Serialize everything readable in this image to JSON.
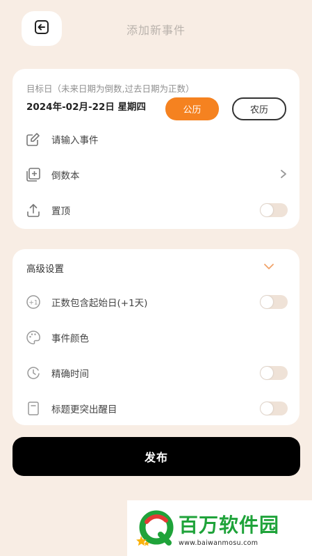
{
  "header": {
    "title": "添加新事件"
  },
  "target": {
    "hint": "目标日（未来日期为倒数,过去日期为正数）",
    "date": "2024年-02月-22日 星期四",
    "solar_label": "公历",
    "lunar_label": "农历"
  },
  "basic": {
    "event_placeholder": "请输入事件",
    "book_label": "倒数本",
    "pin_label": "置顶",
    "pin_on": false
  },
  "advanced": {
    "title": "高级设置",
    "items": [
      {
        "label": "正数包含起始日(+1天)",
        "icon": "plus-one-icon",
        "toggle": false
      },
      {
        "label": "事件颜色",
        "icon": "palette-icon"
      },
      {
        "label": "精确时间",
        "icon": "clock-icon",
        "toggle": false
      },
      {
        "label": "标题更突出醒目",
        "icon": "document-icon",
        "toggle": false
      }
    ]
  },
  "publish_label": "发布",
  "watermark": {
    "name": "百万软件园",
    "url": "www.baiwanmosu.com"
  },
  "colors": {
    "accent": "#f58220",
    "background": "#f8ede4",
    "watermark": "#1fa33a"
  }
}
